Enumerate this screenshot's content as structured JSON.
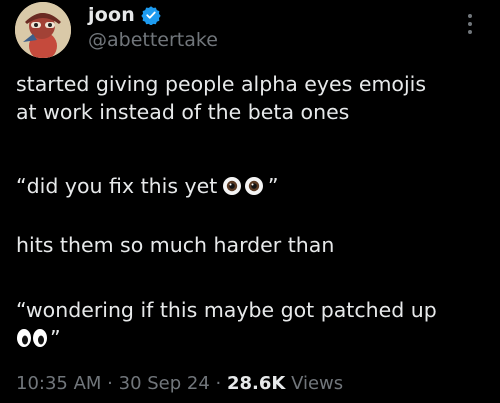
{
  "author": {
    "display_name": "joon",
    "handle": "@abettertake",
    "verified_icon": "verified-badge-icon",
    "avatar": "avatar-image",
    "accent_color": "#1d9bf0"
  },
  "tweet": {
    "line1": "started giving people alpha eyes emojis",
    "line2": "at work instead of the beta ones",
    "quote1_text": "“did you fix this yet ",
    "quote1_close": "”",
    "line4": "hits them so much harder than",
    "quote2_text": "“wondering if this maybe got patched up",
    "quote2_close": "”",
    "emoji_alpha": "eyeball-eyes-emoji-icon",
    "emoji_beta": "cartoon-eyes-emoji-icon"
  },
  "meta": {
    "time": "10:35 AM",
    "sep1": " · ",
    "date": "30 Sep 24",
    "sep2": " · ",
    "views_count": "28.6K",
    "views_label": " Views"
  },
  "menu": {
    "icon": "more-options-icon"
  }
}
